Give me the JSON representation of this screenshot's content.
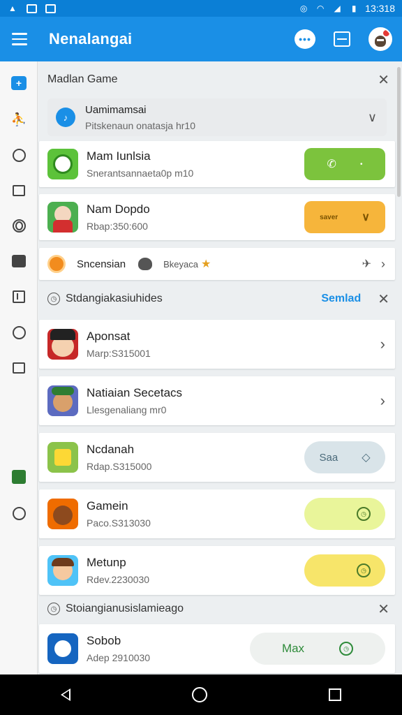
{
  "status_bar": {
    "time": "13:318"
  },
  "app_bar": {
    "title": "Nenalangai"
  },
  "section_game": {
    "title": "Madlan Game",
    "selector": {
      "title": "Uamimamsai",
      "subtitle": "Pitskenaun onatasja hr10"
    },
    "items": [
      {
        "title": "Mam Iunlsia",
        "subtitle": "Snerantsannaeta0p m10",
        "action": "call"
      },
      {
        "title": "Nam Dopdo",
        "subtitle": "Rbap:350:600",
        "action_label": "saver"
      }
    ],
    "achievements": {
      "label1": "Sncensian",
      "label2": "Bkeyaca"
    }
  },
  "section_suggested": {
    "title": "Stdangiakasiuhides",
    "link": "Semlad",
    "items": [
      {
        "title": "Aponsat",
        "subtitle": "Marp:S315001"
      },
      {
        "title": "Natiaian Secetacs",
        "subtitle": "Llesgenaliang mr0"
      },
      {
        "title": "Ncdanah",
        "subtitle": "Rdap.S315000",
        "action_label": "Saa"
      },
      {
        "title": "Gamein",
        "subtitle": "Paco.S313030"
      },
      {
        "title": "Metunp",
        "subtitle": "Rdev.2230030"
      }
    ]
  },
  "section_third": {
    "title": "Stoiangianusislamieago",
    "items": [
      {
        "title": "Sobob",
        "subtitle": "Adep 2910030",
        "action_label": "Max"
      }
    ]
  }
}
